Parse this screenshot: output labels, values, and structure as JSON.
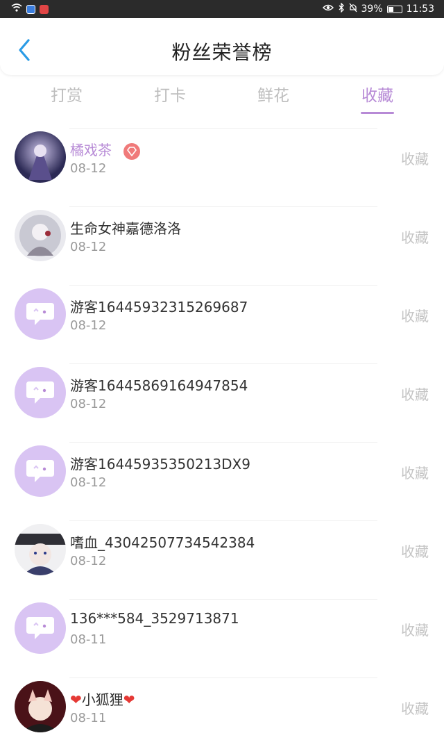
{
  "status_bar": {
    "battery": "39%",
    "time": "11:53"
  },
  "header": {
    "title": "粉丝荣誉榜",
    "back_icon": "chevron-left-icon",
    "accent": "#2a9be6"
  },
  "tabs": [
    {
      "label": "打赏",
      "active": false
    },
    {
      "label": "打卡",
      "active": false
    },
    {
      "label": "鲜花",
      "active": false
    },
    {
      "label": "收藏",
      "active": true
    }
  ],
  "colors": {
    "active_tab": "#b78ad6",
    "guest_avatar": "#d9c4f3",
    "heart": "#e53935"
  },
  "list": [
    {
      "name": "橘戏茶",
      "date": "08-12",
      "action": "收藏",
      "avatar": "photo",
      "badge": "diamond-badge-icon"
    },
    {
      "name": "生命女神嘉德洛洛",
      "date": "08-12",
      "action": "收藏",
      "avatar": "photo"
    },
    {
      "name": "游客1644593231526968​7",
      "date": "08-12",
      "action": "收藏",
      "avatar": "guest"
    },
    {
      "name": "游客16445869164947854",
      "date": "08-12",
      "action": "收藏",
      "avatar": "guest"
    },
    {
      "name": "游客16445935350213DX9",
      "date": "08-12",
      "action": "收藏",
      "avatar": "guest"
    },
    {
      "name": "嗜血_43042507734542384",
      "date": "08-12",
      "action": "收藏",
      "avatar": "photo"
    },
    {
      "name": "136***584_3529713871",
      "date": "08-11",
      "action": "收藏",
      "avatar": "guest"
    },
    {
      "name": "小狐狸",
      "date": "08-11",
      "action": "收藏",
      "avatar": "photo",
      "hearts": true
    }
  ]
}
